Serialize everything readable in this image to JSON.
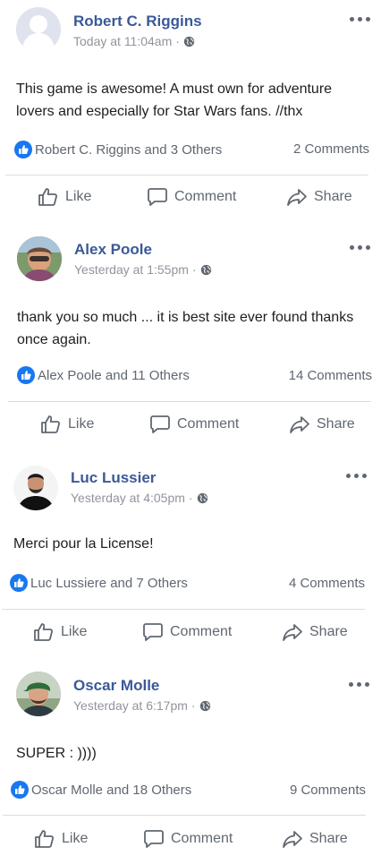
{
  "icons": {
    "more": "more-options-icon",
    "globe": "globe-icon",
    "like_badge": "like-reaction-icon",
    "like": "thumbs-up-icon",
    "comment": "comment-bubble-icon",
    "share": "share-arrow-icon"
  },
  "colors": {
    "author": "#3b5998",
    "meta": "#90949c",
    "muted": "#606770",
    "like_blue": "#1877f2",
    "divider": "#dadde1"
  },
  "posts": [
    {
      "author": "Robert C. Riggins",
      "time": "Today at 11:04am",
      "separator": "·",
      "text": "This game is awesome! A must own for adventure lovers and especially for Star Wars fans. //thx",
      "reactions": "Robert C. Riggins and 3 Others",
      "comments": "2 Comments",
      "actions": {
        "like": "Like",
        "comment": "Comment",
        "share": "Share"
      }
    },
    {
      "author": "Alex Poole",
      "time": "Yesterday at 1:55pm",
      "separator": "·",
      "text": "thank you so much ... it is best site ever found thanks once again.",
      "reactions": "Alex Poole and 11 Others",
      "comments": "14 Comments",
      "actions": {
        "like": "Like",
        "comment": "Comment",
        "share": "Share"
      }
    },
    {
      "author": "Luc Lussier",
      "time": "Yesterday at 4:05pm",
      "separator": "·",
      "text": "Merci pour la License!",
      "reactions": "Luc Lussiere and 7 Others",
      "comments": "4 Comments",
      "actions": {
        "like": "Like",
        "comment": "Comment",
        "share": "Share"
      }
    },
    {
      "author": "Oscar Molle",
      "time": "Yesterday at 6:17pm",
      "separator": "·",
      "text": "SUPER : ))))",
      "reactions": "Oscar Molle and 18 Others",
      "comments": "9 Comments",
      "actions": {
        "like": "Like",
        "comment": "Comment",
        "share": "Share"
      }
    }
  ]
}
